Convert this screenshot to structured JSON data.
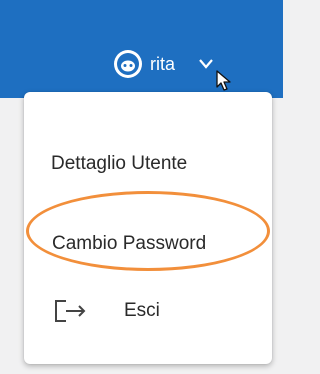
{
  "header": {
    "user": {
      "avatar_icon": "face-icon",
      "name": "rita",
      "dropdown_icon": "chevron-down-icon"
    }
  },
  "user_menu": {
    "items": [
      {
        "label": "Dettaglio Utente"
      },
      {
        "label": "Cambio Password",
        "highlighted": true
      },
      {
        "label": "Esci",
        "icon": "logout-icon"
      }
    ]
  },
  "colors": {
    "header_bg": "#1e6fc1",
    "menu_bg": "#ffffff",
    "highlight_ring": "#f28f3b",
    "text": "#2a2a2a",
    "page_bg": "#f1f1f2"
  }
}
